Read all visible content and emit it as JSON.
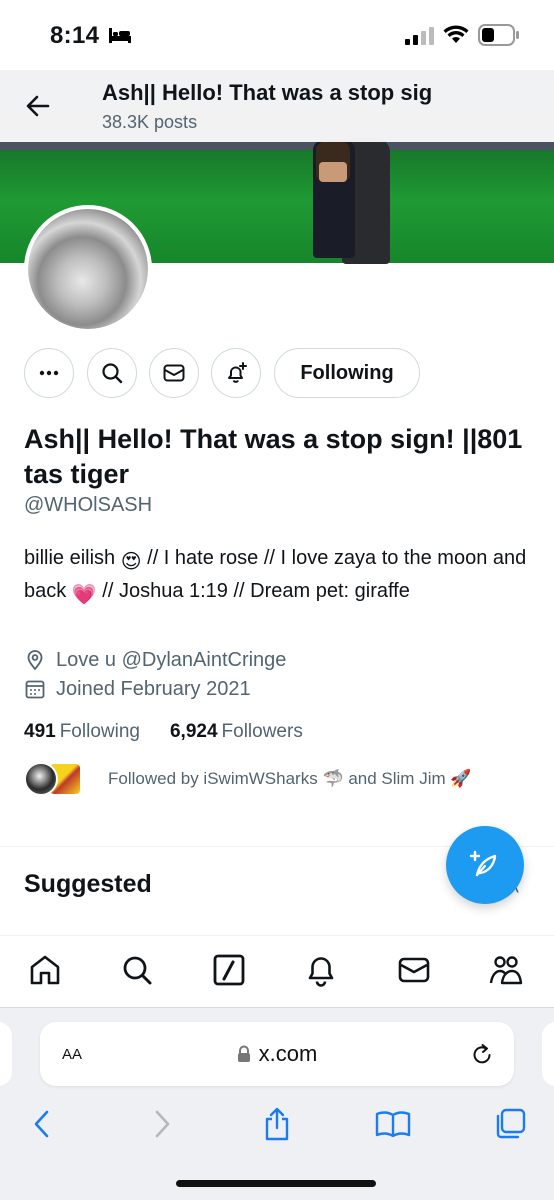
{
  "status_bar": {
    "time": "8:14"
  },
  "header": {
    "title": "Ash|| Hello! That was a stop sig",
    "posts_count": "38.3K posts"
  },
  "actions": {
    "follow_label": "Following"
  },
  "profile": {
    "name": "Ash|| Hello! That was a stop sign! ||801 tas tiger",
    "handle": "@WHOlSASH",
    "bio_part1": "billie eilish ",
    "bio_emoji1": "😍",
    "bio_part2": " // I hate rose // I love zaya to the moon and back ",
    "bio_emoji2": "💗",
    "bio_part3": " // Joshua 1:19 // Dream pet: giraffe",
    "location": "Love u @DylanAintCringe",
    "joined": "Joined February 2021",
    "following_count": "491",
    "following_label": "Following",
    "followers_count": "6,924",
    "followers_label": "Followers",
    "followed_by": "Followed by iSwimWSharks 🦈 and Slim Jim 🚀"
  },
  "sections": {
    "suggested": "Suggested"
  },
  "browser": {
    "aa_label": "AA",
    "url": "x.com"
  },
  "colors": {
    "accent": "#1d9bf0",
    "secondary_text": "#536471",
    "primary_text": "#0f1419"
  }
}
